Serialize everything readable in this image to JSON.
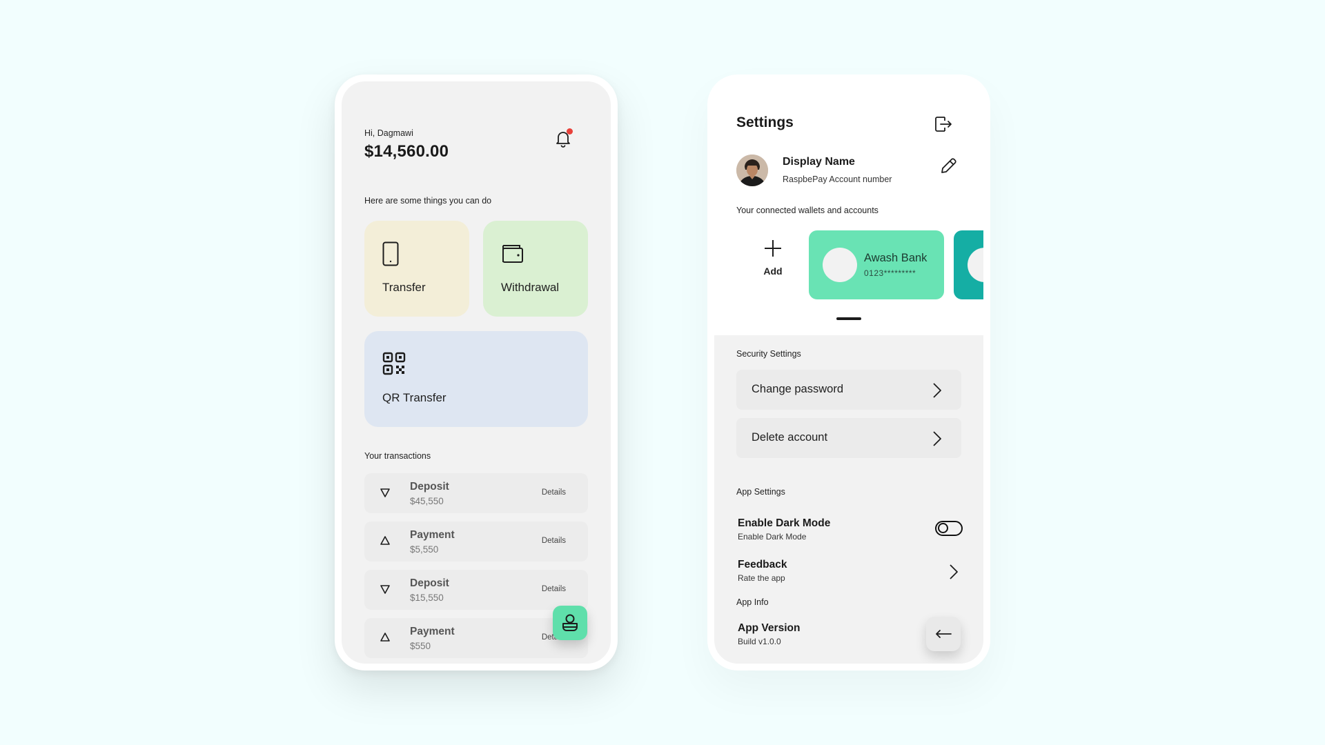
{
  "home": {
    "greeting": "Hi, Dagmawi",
    "balance": "$14,560.00",
    "intro": "Here are some things you can do",
    "actions": {
      "transfer": "Transfer",
      "withdrawal": "Withdrawal",
      "qr_transfer": "QR Transfer"
    },
    "transactions_title": "Your transactions",
    "transactions": [
      {
        "type": "Deposit",
        "amount": "$45,550",
        "details": "Details",
        "direction": "down"
      },
      {
        "type": "Payment",
        "amount": "$5,550",
        "details": "Details",
        "direction": "up"
      },
      {
        "type": "Deposit",
        "amount": "$15,550",
        "details": "Details",
        "direction": "down"
      },
      {
        "type": "Payment",
        "amount": "$550",
        "details": "Details",
        "direction": "up"
      }
    ]
  },
  "settings": {
    "title": "Settings",
    "profile": {
      "display_name": "Display Name",
      "account_number": "RaspbePay Account number"
    },
    "wallets_title": "Your connected wallets and accounts",
    "add_label": "Add",
    "wallets": [
      {
        "name": "Awash Bank",
        "number": "0123*********",
        "color": "#69e3b4"
      },
      {
        "name": "",
        "number": "",
        "color": "#15aea4"
      }
    ],
    "security_title": "Security Settings",
    "security_options": {
      "change_password": "Change password",
      "delete_account": "Delete account"
    },
    "app_settings_title": "App Settings",
    "dark_mode": {
      "title": "Enable Dark Mode",
      "subtitle": "Enable Dark Mode",
      "enabled": false
    },
    "feedback": {
      "title": "Feedback",
      "subtitle": "Rate the app"
    },
    "app_info_title": "App Info",
    "app_version": {
      "title": "App Version",
      "subtitle": "Build v1.0.0"
    }
  },
  "colors": {
    "background": "#f2fefe",
    "accent_green": "#5fdfab",
    "wallet_teal": "#15aea4",
    "notification_dot": "#e8413a"
  },
  "icons": [
    "bell-icon",
    "phone-icon",
    "wallet-icon",
    "qr-code-icon",
    "arrow-down-icon",
    "arrow-up-icon",
    "user-icon",
    "logout-icon",
    "pencil-icon",
    "plus-icon",
    "chevron-right-icon",
    "toggle-switch",
    "arrow-left-icon"
  ]
}
